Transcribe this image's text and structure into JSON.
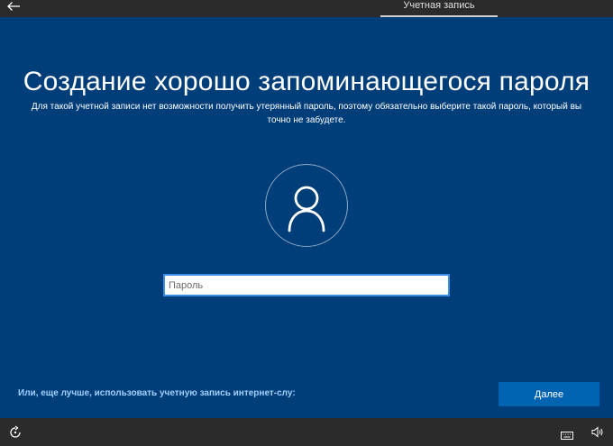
{
  "header": {
    "back_icon": "back-arrow-icon",
    "tab_label": "Учетная запись"
  },
  "main": {
    "title": "Создание хорошо запоминающегося пароля",
    "subtitle": "Для такой учетной записи нет возможности получить утерянный пароль, поэтому обязательно выберите такой пароль, который вы точно не забудете.",
    "avatar_icon": "user-icon",
    "password": {
      "value": "",
      "placeholder": "Пароль"
    },
    "online_account_link": "Или, еще лучше, использовать учетную запись интернет-слу:",
    "next_button": "Далее"
  },
  "footer": {
    "icons": [
      "accessibility-icon",
      "keyboard-icon",
      "volume-icon"
    ]
  },
  "colors": {
    "background": "#003e7a",
    "bars": "#2b2b2b",
    "accent_button": "#0063b1",
    "link": "#9fd0ff",
    "input_border": "#3a8ee6"
  }
}
